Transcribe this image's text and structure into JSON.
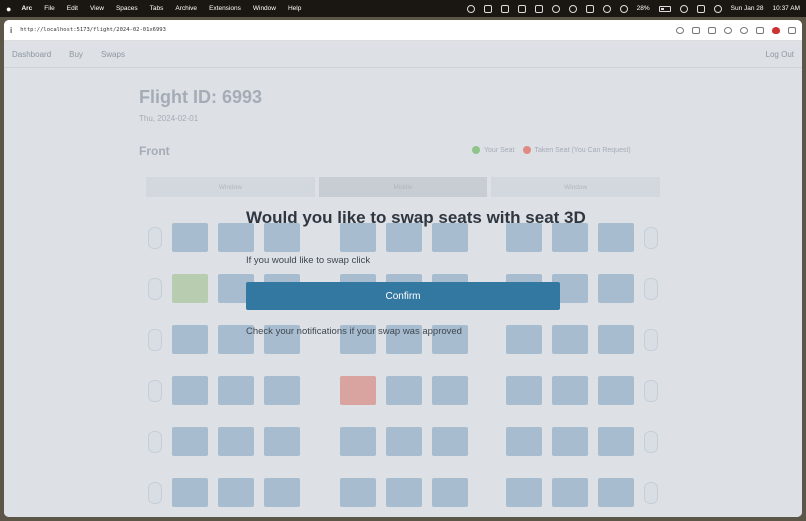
{
  "menubar": {
    "app": "Arc",
    "items": [
      "File",
      "Edit",
      "View",
      "Spaces",
      "Tabs",
      "Archive",
      "Extensions",
      "Window",
      "Help"
    ],
    "battery": "28%",
    "date": "Sun Jan 28",
    "time": "10:37 AM"
  },
  "browser": {
    "url": "http://localhost:5173/flight/2024-02-01x6993"
  },
  "nav": {
    "items": [
      "Dashboard",
      "Buy",
      "Swaps"
    ],
    "logout": "Log Out"
  },
  "flight": {
    "title": "Flight ID: 6993",
    "date": "Thu, 2024-02-01",
    "section": "Front",
    "legend": [
      "Your Seat",
      "Taken Seat (You Can Request)"
    ],
    "cabin_sections": [
      "Window",
      "Middle",
      "Window"
    ]
  },
  "seat_colors": {
    "available": "#a7bdcf",
    "yours": "#b8cdb0",
    "taken": "#d9a4a0"
  },
  "modal": {
    "title": "Would you like to swap seats with seat 3D",
    "subtitle": "If you would like to swap click",
    "confirm_label": "Confirm",
    "note": "Check your notifications if your swap was approved",
    "accent": "#3378a1"
  }
}
